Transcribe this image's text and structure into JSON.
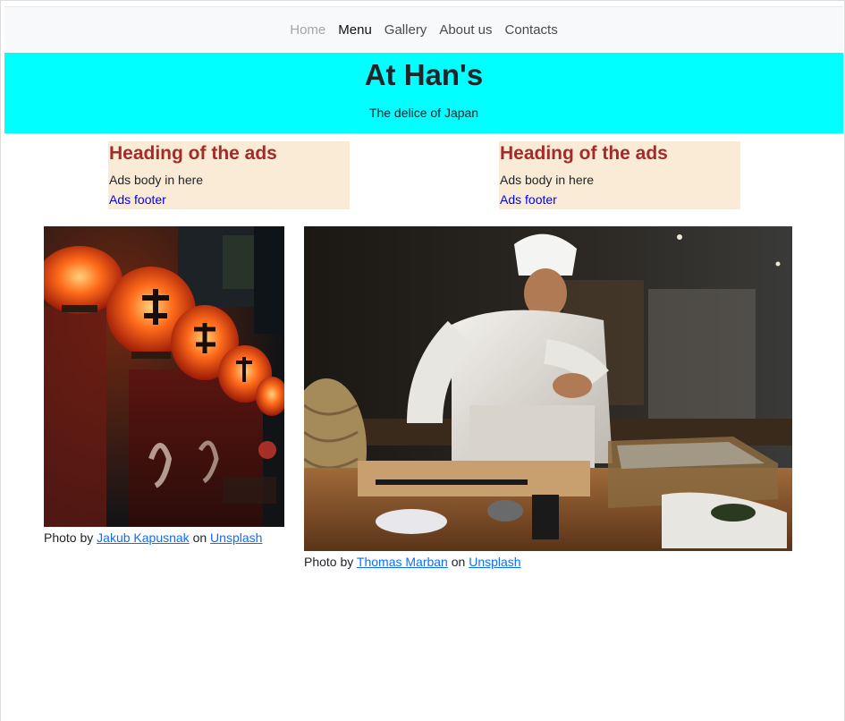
{
  "nav": {
    "items": [
      {
        "label": "Home",
        "state": "disabled"
      },
      {
        "label": "Menu",
        "state": "active"
      },
      {
        "label": "Gallery",
        "state": "normal"
      },
      {
        "label": "About us",
        "state": "normal"
      },
      {
        "label": "Contacts",
        "state": "normal"
      }
    ]
  },
  "hero": {
    "title": "At Han's",
    "subtitle": "The delice of Japan",
    "background": "#00ffff"
  },
  "ads": [
    {
      "heading": "Heading of the ads",
      "body": "Ads body in here",
      "footer": "Ads footer"
    },
    {
      "heading": "Heading of the ads",
      "body": "Ads body in here",
      "footer": "Ads footer"
    }
  ],
  "ad_style": {
    "background": "#faebd7",
    "heading_color": "#a52a2a",
    "footer_color": "#0000ff"
  },
  "photos": [
    {
      "subject": "lanterns-at-night",
      "credit_prefix": "Photo by",
      "author": "Jakub Kapusnak",
      "on": "on",
      "source": "Unsplash"
    },
    {
      "subject": "sushi-chef",
      "credit_prefix": "Photo by",
      "author": "Thomas Marban",
      "on": "on",
      "source": "Unsplash"
    }
  ]
}
